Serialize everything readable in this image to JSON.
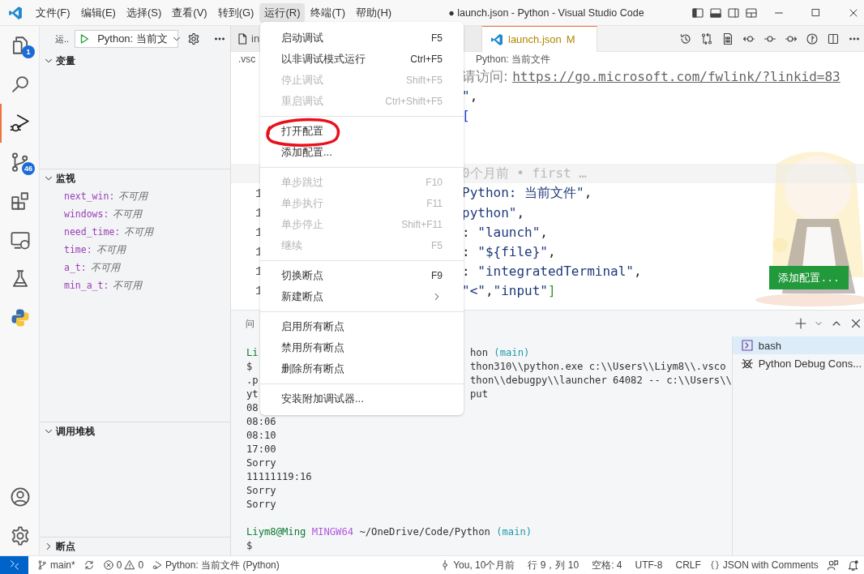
{
  "title_bar": {
    "menus": [
      {
        "label": "文件(F)",
        "selected": false
      },
      {
        "label": "编辑(E)",
        "selected": false
      },
      {
        "label": "选择(S)",
        "selected": false
      },
      {
        "label": "查看(V)",
        "selected": false
      },
      {
        "label": "转到(G)",
        "selected": false
      },
      {
        "label": "运行(R)",
        "selected": true
      },
      {
        "label": "终端(T)",
        "selected": false
      },
      {
        "label": "帮助(H)",
        "selected": false
      }
    ],
    "title": "● launch.json - Python - Visual Studio Code"
  },
  "activity_bar": {
    "items": [
      {
        "kind": "explorer",
        "badge": "1",
        "selected": false
      },
      {
        "kind": "search",
        "selected": false
      },
      {
        "kind": "debug",
        "selected": true
      },
      {
        "kind": "scm",
        "badge": "46",
        "selected": false
      },
      {
        "kind": "extensions",
        "selected": false
      },
      {
        "kind": "remote",
        "selected": false
      },
      {
        "kind": "testing",
        "selected": false
      },
      {
        "kind": "python",
        "selected": false
      }
    ],
    "bottom": [
      {
        "kind": "account"
      },
      {
        "kind": "settings"
      }
    ]
  },
  "sidebar": {
    "title": "运..",
    "configuration": "Python: 当前文",
    "sections": [
      {
        "title": "变量",
        "expanded": true
      },
      {
        "title": "监视",
        "expanded": true,
        "items": [
          {
            "name": "next_win:",
            "value": "不可用"
          },
          {
            "name": "windows:",
            "value": "不可用"
          },
          {
            "name": "need_time:",
            "value": "不可用"
          },
          {
            "name": "time:",
            "value": "不可用"
          },
          {
            "name": "a_t:",
            "value": "不可用"
          },
          {
            "name": "min_a_t:",
            "value": "不可用"
          }
        ]
      },
      {
        "title": "调用堆栈",
        "expanded": true
      },
      {
        "title": "断点",
        "expanded": false
      }
    ]
  },
  "editor": {
    "tabs": [
      {
        "label": "in",
        "modified": false,
        "selected": false
      },
      {
        "label": "launch.json",
        "status": "M",
        "modified": true,
        "selected": true
      }
    ],
    "breadcrumb": [
      ".vsc",
      "Python: 当前文件"
    ],
    "lines": [
      {
        "kind": "code",
        "segments": [
          {
            "kind": "comment",
            "text": "请访问: "
          },
          {
            "kind": "link",
            "text": "https://go.microsoft.com/fwlink/?linkid=83"
          }
        ]
      },
      {
        "kind": "code",
        "segments": [
          {
            "kind": "string",
            "text": "\""
          },
          {
            "kind": "punct",
            "text": ","
          }
        ]
      },
      {
        "kind": "code",
        "segments": [
          {
            "kind": "bracket",
            "text": "["
          }
        ]
      },
      {
        "kind": "blank"
      },
      {
        "kind": "blank"
      },
      {
        "kind": "blame",
        "segments": [
          {
            "kind": "blame",
            "text": "0个月前 • first …"
          }
        ]
      },
      {
        "number": "1",
        "segments": [
          {
            "kind": "string",
            "text": "Python: 当前文件\""
          },
          {
            "kind": "punct",
            "text": ","
          }
        ]
      },
      {
        "number": "1",
        "segments": [
          {
            "kind": "string",
            "text": "python\""
          },
          {
            "kind": "punct",
            "text": ","
          }
        ]
      },
      {
        "number": "1",
        "segments": [
          {
            "kind": "punct",
            "text": ": "
          },
          {
            "kind": "string",
            "text": "\"launch\""
          },
          {
            "kind": "punct",
            "text": ","
          }
        ]
      },
      {
        "number": "1",
        "segments": [
          {
            "kind": "punct",
            "text": ": "
          },
          {
            "kind": "string",
            "text": "\"${file}\""
          },
          {
            "kind": "punct",
            "text": ","
          }
        ]
      },
      {
        "number": "1",
        "segments": [
          {
            "kind": "punct",
            "text": ": "
          },
          {
            "kind": "string",
            "text": "\"integratedTerminal\""
          },
          {
            "kind": "punct",
            "text": ","
          }
        ]
      },
      {
        "number": "1",
        "segments": [
          {
            "kind": "string",
            "text": "\"<\""
          },
          {
            "kind": "punct",
            "text": ","
          },
          {
            "kind": "string",
            "text": "\"input\""
          },
          {
            "kind": "bracket2",
            "text": "]"
          }
        ]
      }
    ],
    "add_configuration_button": "添加配置..."
  },
  "panel": {
    "tab": "问",
    "terminal_lines": [
      {
        "left": [
          {
            "kind": "user",
            "text": "Li"
          }
        ],
        "right": [
          {
            "kind": "plain",
            "text": "hon "
          },
          {
            "kind": "branch",
            "text": "(main)"
          }
        ]
      },
      {
        "left": [
          {
            "kind": "plain",
            "text": "$"
          }
        ],
        "right": [
          {
            "kind": "plain",
            "text": "thon310\\\\python.exe c:\\\\Users\\\\Liym8\\\\.vsco"
          }
        ]
      },
      {
        "left": [
          {
            "kind": "plain",
            "text": ".p"
          }
        ],
        "right": [
          {
            "kind": "plain",
            "text": "thon\\\\debugpy\\\\launcher 64082 -- c:\\\\Users\\\\"
          }
        ]
      },
      {
        "left": [
          {
            "kind": "plain",
            "text": "yt"
          }
        ],
        "right": [
          {
            "kind": "plain",
            "text": "put"
          }
        ]
      },
      {
        "left": [
          {
            "kind": "plain",
            "text": "08"
          }
        ]
      },
      {
        "left": [
          {
            "kind": "plain",
            "text": "08:06"
          }
        ]
      },
      {
        "left": [
          {
            "kind": "plain",
            "text": "08:10"
          }
        ]
      },
      {
        "left": [
          {
            "kind": "plain",
            "text": "17:00"
          }
        ]
      },
      {
        "left": [
          {
            "kind": "plain",
            "text": "Sorry"
          }
        ]
      },
      {
        "left": [
          {
            "kind": "plain",
            "text": "11111119:16"
          }
        ]
      },
      {
        "left": [
          {
            "kind": "plain",
            "text": "Sorry"
          }
        ]
      },
      {
        "left": [
          {
            "kind": "plain",
            "text": "Sorry"
          }
        ]
      },
      {
        "kind": "blank"
      },
      {
        "left": [
          {
            "kind": "user",
            "text": "Liym8@Ming "
          },
          {
            "kind": "host",
            "text": "MINGW64 "
          },
          {
            "kind": "plain",
            "text": "~/OneDrive/Code/Python "
          },
          {
            "kind": "branch",
            "text": "(main)"
          }
        ]
      },
      {
        "left": [
          {
            "kind": "plain",
            "text": "$"
          }
        ]
      }
    ],
    "terminals": [
      {
        "kind": "shell",
        "label": "bash",
        "selected": true
      },
      {
        "kind": "debug",
        "label": "Python Debug Cons...",
        "selected": false
      }
    ]
  },
  "menu": {
    "items": [
      {
        "kind": "item",
        "label": "启动调试",
        "shortcut": "F5",
        "disabled": false,
        "circled": false
      },
      {
        "kind": "item",
        "label": "以非调试模式运行",
        "shortcut": "Ctrl+F5",
        "disabled": false,
        "circled": false
      },
      {
        "kind": "item",
        "label": "停止调试",
        "shortcut": "Shift+F5",
        "disabled": true,
        "circled": false
      },
      {
        "kind": "item",
        "label": "重启调试",
        "shortcut": "Ctrl+Shift+F5",
        "disabled": true,
        "circled": false
      },
      {
        "kind": "separator"
      },
      {
        "kind": "item",
        "label": "打开配置",
        "disabled": false,
        "circled": true
      },
      {
        "kind": "item",
        "label": "添加配置...",
        "disabled": false,
        "circled": false
      },
      {
        "kind": "separator"
      },
      {
        "kind": "item",
        "label": "单步跳过",
        "shortcut": "F10",
        "disabled": true,
        "circled": false
      },
      {
        "kind": "item",
        "label": "单步执行",
        "shortcut": "F11",
        "disabled": true,
        "circled": false
      },
      {
        "kind": "item",
        "label": "单步停止",
        "shortcut": "Shift+F11",
        "disabled": true,
        "circled": false
      },
      {
        "kind": "item",
        "label": "继续",
        "shortcut": "F5",
        "disabled": true,
        "circled": false
      },
      {
        "kind": "separator"
      },
      {
        "kind": "item",
        "label": "切换断点",
        "shortcut": "F9",
        "disabled": false,
        "circled": false
      },
      {
        "kind": "submenu",
        "label": "新建断点",
        "disabled": false,
        "circled": false
      },
      {
        "kind": "separator"
      },
      {
        "kind": "item",
        "label": "启用所有断点",
        "disabled": false,
        "circled": false
      },
      {
        "kind": "item",
        "label": "禁用所有断点",
        "disabled": false,
        "circled": false
      },
      {
        "kind": "item",
        "label": "删除所有断点",
        "disabled": false,
        "circled": false
      },
      {
        "kind": "separator"
      },
      {
        "kind": "item",
        "label": "安装附加调试器...",
        "disabled": false,
        "circled": false
      }
    ]
  },
  "status_bar": {
    "left": [
      {
        "kind": "remote"
      },
      {
        "kind": "branch",
        "label": "main*"
      },
      {
        "kind": "sync"
      },
      {
        "kind": "problems",
        "errors": "0",
        "warnings": "0"
      },
      {
        "kind": "debug",
        "label": "Python: 当前文件 (Python)"
      }
    ],
    "right": [
      {
        "kind": "blame",
        "label": "You, 10个月前"
      },
      {
        "kind": "text",
        "label": "行 9，列 10"
      },
      {
        "kind": "text",
        "label": "空格: 4"
      },
      {
        "kind": "text",
        "label": "UTF-8"
      },
      {
        "kind": "text",
        "label": "CRLF"
      },
      {
        "kind": "language",
        "label": "JSON with Comments"
      },
      {
        "kind": "feedback"
      },
      {
        "kind": "bell"
      }
    ]
  }
}
